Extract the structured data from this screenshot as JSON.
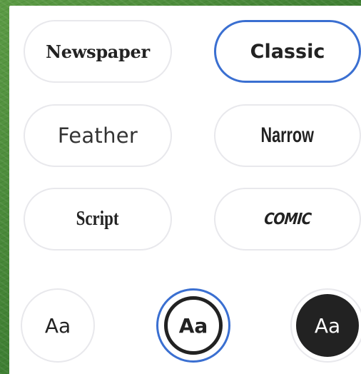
{
  "font_styles": [
    {
      "id": "newspaper",
      "label": "Newspaper",
      "selected": false
    },
    {
      "id": "classic",
      "label": "Classic",
      "selected": true
    },
    {
      "id": "feather",
      "label": "Feather",
      "selected": false
    },
    {
      "id": "narrow",
      "label": "Narrow",
      "selected": false
    },
    {
      "id": "script",
      "label": "Script",
      "selected": false
    },
    {
      "id": "comic",
      "label": "COMIC",
      "selected": false
    }
  ],
  "text_styles": [
    {
      "id": "plain",
      "label": "Aa",
      "selected": false
    },
    {
      "id": "outlined",
      "label": "Aa",
      "selected": true
    },
    {
      "id": "filled",
      "label": "Aa",
      "selected": false
    }
  ],
  "colors": {
    "selected_border": "#3a6fd1",
    "pill_border": "#e8e8ec",
    "dark_fill": "#222222",
    "background": "#4a8a3c"
  }
}
